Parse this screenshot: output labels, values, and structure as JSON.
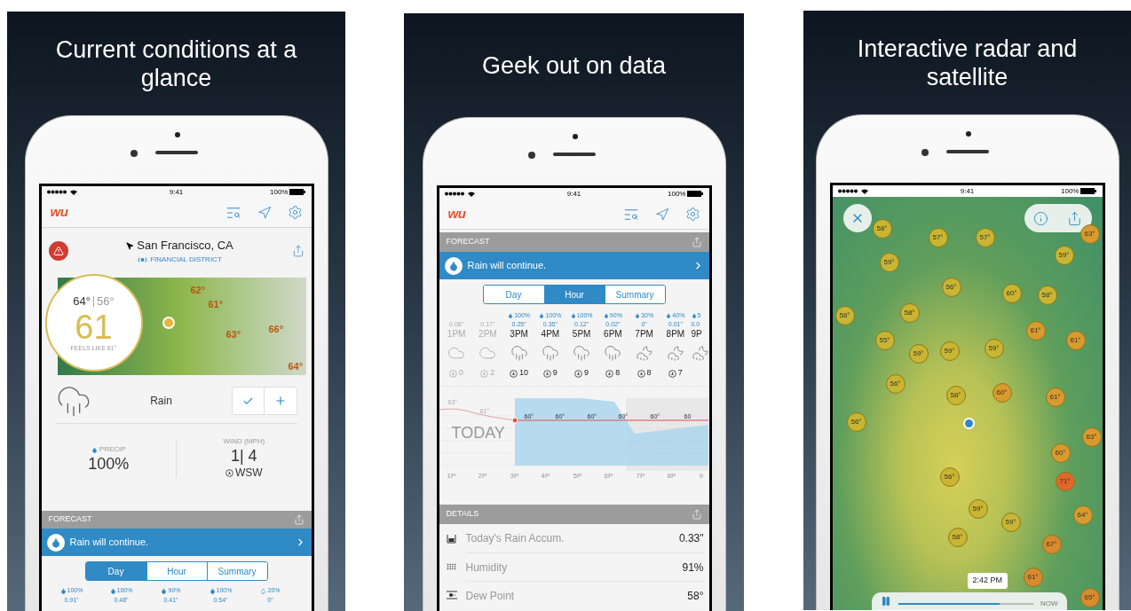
{
  "panels": [
    {
      "kind": "current",
      "title": "Current conditions at a glance",
      "status": {
        "time": "9:41",
        "battery": "100%"
      },
      "logo": "wu",
      "location": {
        "city": "San Francisco, CA",
        "station": "FINANCIAL DISTRICT"
      },
      "temps": {
        "high": "64°",
        "low": "56°",
        "current": "61",
        "feels_like": "FEELS LIKE 61°"
      },
      "map_temps": [
        "62°",
        "61°",
        "63°",
        "66°",
        "64°"
      ],
      "condition": "Rain",
      "precip": {
        "label": "PRECIP",
        "value": "100%"
      },
      "wind": {
        "label": "WIND (MPH)",
        "value": "1| 4",
        "direction": "WSW"
      },
      "forecast": {
        "header": "FORECAST",
        "banner": "Rain will continue.",
        "tabs": [
          {
            "label": "Day",
            "selected": true
          },
          {
            "label": "Hour",
            "selected": false
          },
          {
            "label": "Summary",
            "selected": false
          }
        ],
        "days": [
          {
            "precip": "100%",
            "amount": "0.91\"",
            "rain": true
          },
          {
            "precip": "100%",
            "amount": "0.48\"",
            "rain": true
          },
          {
            "precip": "90%",
            "amount": "0.41\"",
            "rain": true
          },
          {
            "precip": "100%",
            "amount": "0.54\"",
            "rain": true
          },
          {
            "precip": "20%",
            "amount": "0\"",
            "rain": false
          }
        ]
      }
    },
    {
      "kind": "data",
      "title": "Geek out on data",
      "status": {
        "time": "9:41",
        "battery": "100%"
      },
      "logo": "wu",
      "forecast": {
        "header": "FORECAST",
        "banner": "Rain will continue.",
        "tabs": [
          {
            "label": "Day",
            "selected": false
          },
          {
            "label": "Hour",
            "selected": true
          },
          {
            "label": "Summary",
            "selected": false
          }
        ],
        "hours": [
          {
            "kind": "cloud",
            "amount": "0.08\"",
            "time": "1PM",
            "wind": "0",
            "past": true
          },
          {
            "kind": "cloud",
            "amount": "0.17\"",
            "time": "2PM",
            "wind": "2",
            "past": true
          },
          {
            "kind": "rain",
            "precip": "100%",
            "amount": "0.25\"",
            "time": "3PM",
            "wind": "10",
            "past": false
          },
          {
            "kind": "rain",
            "precip": "100%",
            "amount": "0.35\"",
            "time": "4PM",
            "wind": "9",
            "past": false
          },
          {
            "kind": "rain",
            "precip": "100%",
            "amount": "0.12\"",
            "time": "5PM",
            "wind": "9",
            "past": false
          },
          {
            "kind": "rain",
            "precip": "90%",
            "amount": "0.02\"",
            "time": "6PM",
            "wind": "8",
            "past": false
          },
          {
            "kind": "night",
            "precip": "30%",
            "amount": "0\"",
            "time": "7PM",
            "wind": "8",
            "past": false
          },
          {
            "kind": "night",
            "precip": "40%",
            "amount": "0.01\"",
            "time": "8PM",
            "wind": "7",
            "past": false
          },
          {
            "kind": "night",
            "precip": "5",
            "amount": "0.0",
            "time": "9P",
            "past": false
          }
        ]
      },
      "chart": {
        "label": "TODAY",
        "temp_labels": [
          "63°",
          "61°",
          "60°",
          "60°",
          "60°",
          "60°",
          "60°",
          "60"
        ],
        "time_labels": [
          "1P",
          "2P",
          "3P",
          "4P",
          "5P",
          "6P",
          "7P",
          "8P",
          "9"
        ]
      },
      "details": {
        "header": "DETAILS",
        "rows": [
          {
            "kind": "rain",
            "label": "Today's Rain Accum.",
            "value": "0.33\""
          },
          {
            "kind": "humidity",
            "label": "Humidity",
            "value": "91%"
          },
          {
            "kind": "dew",
            "label": "Dew Point",
            "value": "58°"
          }
        ]
      }
    },
    {
      "kind": "radar",
      "title": "Interactive radar and satellite",
      "status": {
        "time": "9:41",
        "battery": "100%"
      },
      "pins": [
        {
          "label": "58°",
          "color": "#c9b531"
        },
        {
          "label": "57°",
          "color": "#c9b531"
        },
        {
          "label": "57°",
          "color": "#c9b531"
        },
        {
          "label": "63°",
          "color": "#d99a2e"
        },
        {
          "label": "59°",
          "color": "#c9b531"
        },
        {
          "label": "59°",
          "color": "#c9b531"
        },
        {
          "label": "56°",
          "color": "#c9b531"
        },
        {
          "label": "60°",
          "color": "#c9b531"
        },
        {
          "label": "58°",
          "color": "#c9b531"
        },
        {
          "label": "58°",
          "color": "#c9b531"
        },
        {
          "label": "58°",
          "color": "#c9b531"
        },
        {
          "label": "55°",
          "color": "#c9b531"
        },
        {
          "label": "61°",
          "color": "#d99a2e"
        },
        {
          "label": "61°",
          "color": "#d99a2e"
        },
        {
          "label": "59°",
          "color": "#c9b531"
        },
        {
          "label": "59°",
          "color": "#c9b531"
        },
        {
          "label": "59°",
          "color": "#c9b531"
        },
        {
          "label": "56°",
          "color": "#c9b531"
        },
        {
          "label": "58°",
          "color": "#c9b531"
        },
        {
          "label": "60°",
          "color": "#d99a2e"
        },
        {
          "label": "61°",
          "color": "#d99a2e"
        },
        {
          "label": "56°",
          "color": "#c9b531"
        },
        {
          "label": "63°",
          "color": "#d99a2e"
        },
        {
          "label": "60°",
          "color": "#d99a2e"
        },
        {
          "label": "56°",
          "color": "#c9b531"
        },
        {
          "label": "71°",
          "color": "#e0662c"
        },
        {
          "label": "64°",
          "color": "#d99a2e"
        },
        {
          "label": "59°",
          "color": "#c9b531"
        },
        {
          "label": "59°",
          "color": "#c9b531"
        },
        {
          "label": "58°",
          "color": "#c9b531"
        },
        {
          "label": "67°",
          "color": "#d98a2e"
        },
        {
          "label": "61°",
          "color": "#d98a2e"
        },
        {
          "label": "65°",
          "color": "#d98a2e"
        }
      ],
      "time_tooltip": "2:42 PM",
      "slider": {
        "level": 0.75,
        "end_label": "NOW",
        "playing": true
      }
    }
  ]
}
